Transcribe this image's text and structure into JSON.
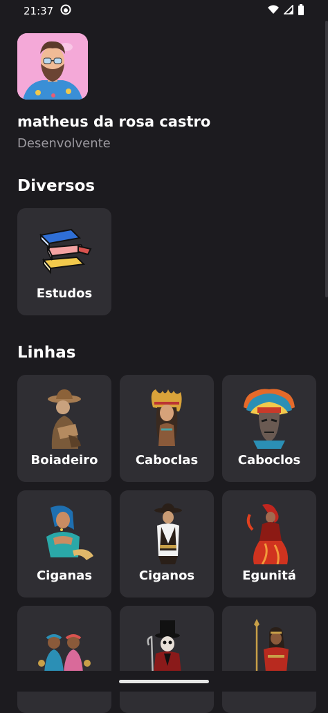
{
  "status_bar": {
    "time": "21:37",
    "icons": [
      "app-notification-icon",
      "wifi-icon",
      "cell-signal-icon",
      "battery-icon"
    ]
  },
  "profile": {
    "name": "matheus da rosa castro",
    "role": "Desenvolvente"
  },
  "sections": {
    "diversos": {
      "title": "Diversos",
      "items": [
        {
          "label": "Estudos",
          "icon": "books-icon"
        }
      ]
    },
    "linhas": {
      "title": "Linhas",
      "items": [
        {
          "label": "Boiadeiro",
          "icon": "boiadeiro-figure"
        },
        {
          "label": "Caboclas",
          "icon": "caboclas-figure"
        },
        {
          "label": "Caboclos",
          "icon": "caboclos-figure"
        },
        {
          "label": "Ciganas",
          "icon": "ciganas-figure"
        },
        {
          "label": "Ciganos",
          "icon": "ciganos-figure"
        },
        {
          "label": "Egunitá",
          "icon": "egunita-figure"
        },
        {
          "label": "",
          "icon": "children-figure"
        },
        {
          "label": "",
          "icon": "top-hat-figure"
        },
        {
          "label": "",
          "icon": "warrior-figure"
        }
      ]
    }
  },
  "colors": {
    "background": "#1c1b1f",
    "card": "#2f2e33",
    "text_primary": "#ffffff",
    "text_secondary": "#9c9aa0"
  }
}
